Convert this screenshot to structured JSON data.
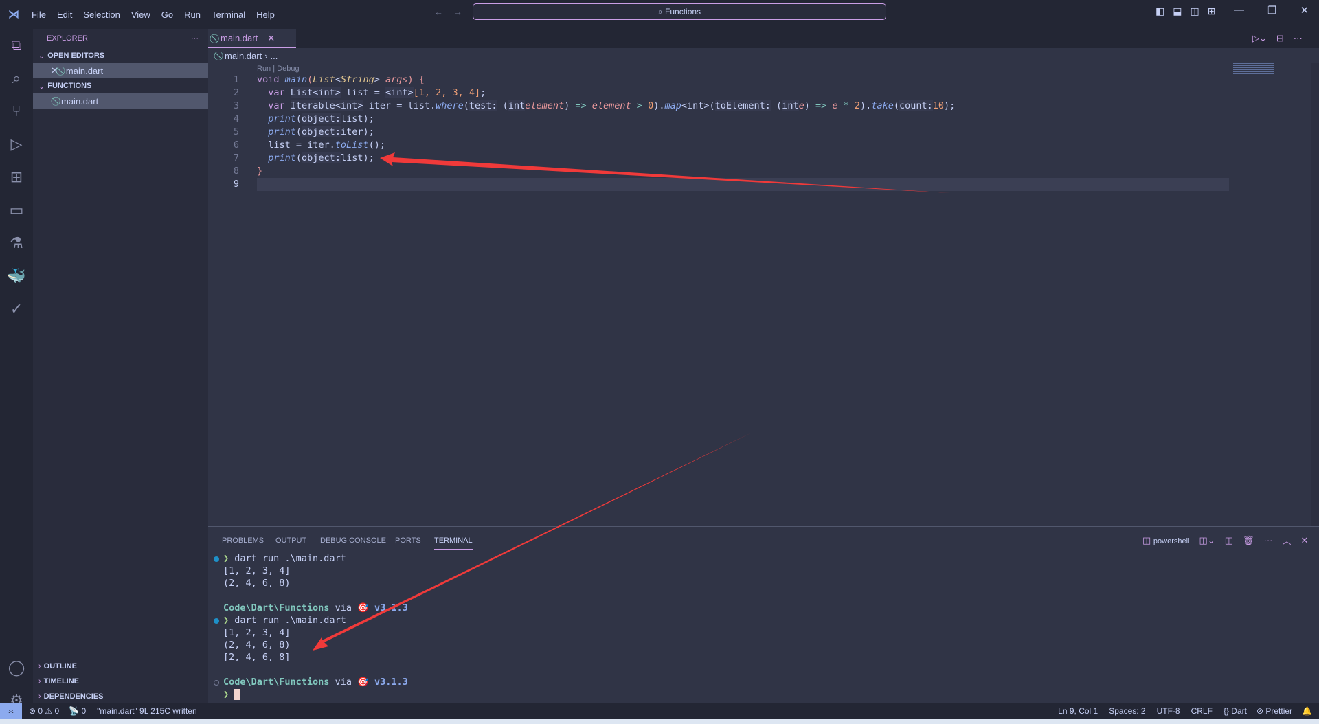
{
  "titlebar": {
    "menu": [
      "File",
      "Edit",
      "Selection",
      "View",
      "Go",
      "Run",
      "Terminal",
      "Help"
    ],
    "search": "Functions"
  },
  "sidebar": {
    "title": "EXPLORER",
    "open_editors": "OPEN EDITORS",
    "open_file": "main.dart",
    "folder": "FUNCTIONS",
    "folder_file": "main.dart",
    "outline": "OUTLINE",
    "timeline": "TIMELINE",
    "dependencies": "DEPENDENCIES"
  },
  "editor": {
    "tab": "main.dart",
    "breadcrumb": "main.dart",
    "breadcrumb_more": "...",
    "codelens": "Run | Debug",
    "lines": [
      [
        [
          "kw",
          "void "
        ],
        [
          "fn",
          "main"
        ],
        [
          "br",
          "("
        ],
        [
          "ty",
          "List"
        ],
        [
          "pl",
          "<"
        ],
        [
          "ty",
          "String"
        ],
        [
          "pl",
          "> "
        ],
        [
          "pa",
          "args"
        ],
        [
          "br",
          ") {"
        ]
      ],
      [
        [
          "pl",
          "  "
        ],
        [
          "kw",
          "var "
        ],
        [
          "lb",
          "List<int>"
        ],
        [
          "pl",
          " list = "
        ],
        [
          "lb",
          "<int>"
        ],
        [
          "nu",
          "[1, 2, 3, 4]"
        ],
        [
          "pl",
          ";"
        ]
      ],
      [
        [
          "pl",
          "  "
        ],
        [
          "kw",
          "var "
        ],
        [
          "lb",
          "Iterable<int>"
        ],
        [
          "pl",
          " iter = list."
        ],
        [
          "fn",
          "where"
        ],
        [
          "pl",
          "("
        ],
        [
          "lb",
          "test:"
        ],
        [
          "pl",
          " ("
        ],
        [
          "lb",
          "int"
        ],
        [
          "pa",
          "element"
        ],
        [
          "pl",
          ") "
        ],
        [
          "op",
          "=>"
        ],
        [
          "pa",
          " element"
        ],
        [
          "op",
          " > "
        ],
        [
          "nu",
          "0"
        ],
        [
          "pl",
          ")."
        ],
        [
          "fn",
          "map"
        ],
        [
          "pl",
          "<int>("
        ],
        [
          "lb",
          "toElement:"
        ],
        [
          "pl",
          " ("
        ],
        [
          "lb",
          "int"
        ],
        [
          "pa",
          "e"
        ],
        [
          "pl",
          ") "
        ],
        [
          "op",
          "=>"
        ],
        [
          "pa",
          " e"
        ],
        [
          "op",
          " * "
        ],
        [
          "nu",
          "2"
        ],
        [
          "pl",
          ")."
        ],
        [
          "fn",
          "take"
        ],
        [
          "pl",
          "("
        ],
        [
          "lb",
          "count:"
        ],
        [
          "nu",
          "10"
        ],
        [
          "pl",
          ");"
        ]
      ],
      [
        [
          "pl",
          "  "
        ],
        [
          "fn",
          "print"
        ],
        [
          "pl",
          "("
        ],
        [
          "lb",
          "object:"
        ],
        [
          "pl",
          "list);"
        ]
      ],
      [
        [
          "pl",
          "  "
        ],
        [
          "fn",
          "print"
        ],
        [
          "pl",
          "("
        ],
        [
          "lb",
          "object:"
        ],
        [
          "pl",
          "iter);"
        ]
      ],
      [
        [
          "pl",
          "  list = iter."
        ],
        [
          "fn",
          "toList"
        ],
        [
          "pl",
          "();"
        ]
      ],
      [
        [
          "pl",
          "  "
        ],
        [
          "fn",
          "print"
        ],
        [
          "pl",
          "("
        ],
        [
          "lb",
          "object:"
        ],
        [
          "pl",
          "list);"
        ]
      ],
      [
        [
          "br",
          "}"
        ]
      ],
      [
        [
          "pl",
          ""
        ]
      ]
    ]
  },
  "panel": {
    "tabs": [
      "PROBLEMS",
      "OUTPUT",
      "DEBUG CONSOLE",
      "PORTS",
      "TERMINAL"
    ],
    "shell": "powershell",
    "terminal": [
      {
        "dot": "blue",
        "prompt": "❯ ",
        "cmd": "dart run .\\main.dart"
      },
      {
        "out": "[1, 2, 3, 4]"
      },
      {
        "out": "(2, 4, 6, 8)"
      },
      {
        "out": ""
      },
      {
        "path": "Code\\Dart\\Functions",
        "via": " via ",
        "ver": "🎯 v3.1.3"
      },
      {
        "dot": "blue",
        "prompt": "❯ ",
        "cmd": "dart run .\\main.dart"
      },
      {
        "out": "[1, 2, 3, 4]"
      },
      {
        "out": "(2, 4, 6, 8)"
      },
      {
        "out": "[2, 4, 6, 8]"
      },
      {
        "out": ""
      },
      {
        "dot": "hollow",
        "path": "Code\\Dart\\Functions",
        "via": " via ",
        "ver": "🎯 v3.1.3"
      },
      {
        "prompt": "❯ ",
        "cursor": true
      }
    ]
  },
  "status": {
    "errors": "0",
    "warnings": "0",
    "ports": "0",
    "message": "\"main.dart\" 9L 215C written",
    "position": "Ln 9, Col 1",
    "spaces": "Spaces: 2",
    "encoding": "UTF-8",
    "eol": "CRLF",
    "language": "Dart",
    "formatter": "Prettier"
  },
  "colors": {
    "accent": "#ca9ee6",
    "annotation_arrow": "#f03a3a"
  }
}
